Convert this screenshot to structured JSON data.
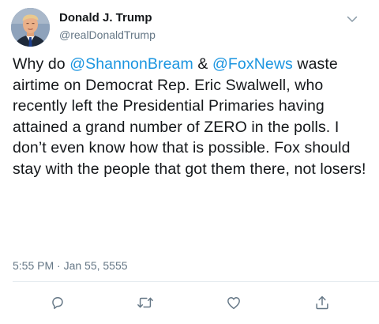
{
  "author": {
    "name": "Donald J. Trump",
    "handle": "@realDonaldTrump"
  },
  "tweet": {
    "segments": [
      {
        "type": "text",
        "text": "Why do "
      },
      {
        "type": "mention",
        "text": "@ShannonBream"
      },
      {
        "type": "text",
        "text": " & "
      },
      {
        "type": "mention",
        "text": "@FoxNews"
      },
      {
        "type": "text",
        "text": " waste airtime on Democrat Rep. Eric Swalwell, who recently left the Presidential Primaries having attained a grand number of ZERO in the polls. I don’t even know how that is possible. Fox should stay with the people that got them there, not losers!"
      }
    ],
    "timestamp": "5:55 PM · Jan 55, 5555"
  },
  "actions": {
    "reply_icon": "reply-icon",
    "retweet_icon": "retweet-icon",
    "like_icon": "heart-icon",
    "share_icon": "share-icon"
  },
  "colors": {
    "link": "#1b95e0",
    "secondary_text": "#657786",
    "primary_text": "#14171a",
    "divider": "#e1e8ed"
  }
}
